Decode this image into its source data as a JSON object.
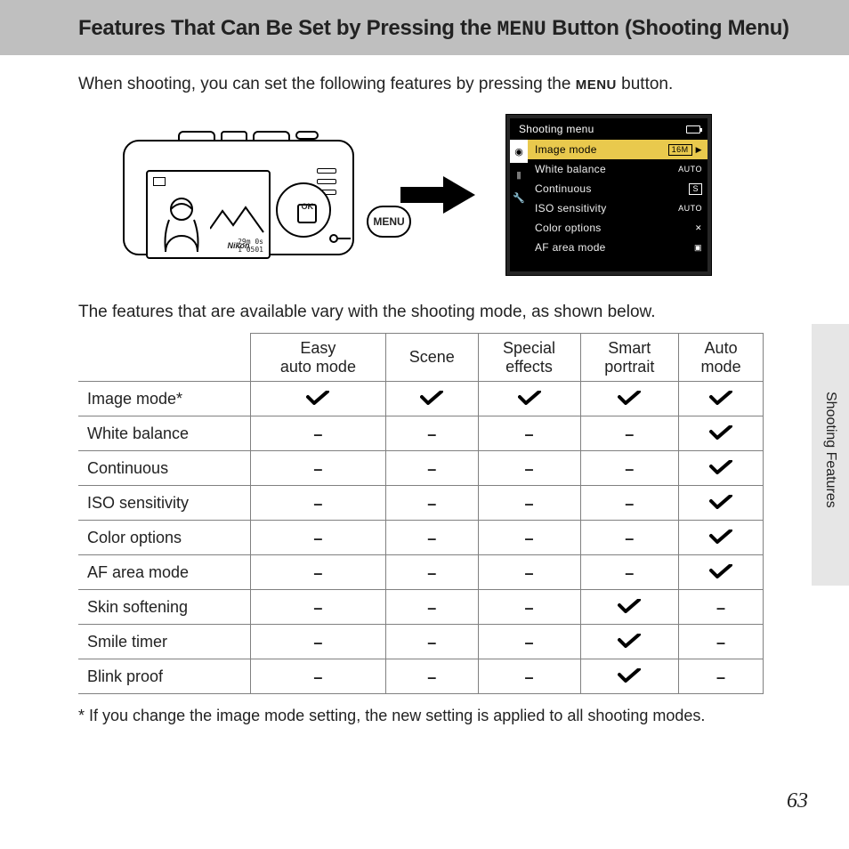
{
  "title": {
    "pre": "Features That Can Be Set by Pressing the ",
    "menu_word": "MENU",
    "post": " Button (Shooting Menu)"
  },
  "intro": {
    "pre": "When shooting, you can set the following features by pressing the ",
    "menu_word": "MENU",
    "post": " button."
  },
  "callout": {
    "menu_label": "MENU"
  },
  "camera": {
    "brand": "Nikon",
    "ok": "OK"
  },
  "shooting_menu": {
    "header": "Shooting menu",
    "rows": [
      {
        "label": "Image mode",
        "value": "16M",
        "style": "chip",
        "selected": true
      },
      {
        "label": "White balance",
        "value": "AUTO",
        "style": "text"
      },
      {
        "label": "Continuous",
        "value": "S",
        "style": "chip"
      },
      {
        "label": "ISO sensitivity",
        "value": "AUTO",
        "style": "text"
      },
      {
        "label": "Color options",
        "value": "✕",
        "style": "icon"
      },
      {
        "label": "AF area mode",
        "value": "▣",
        "style": "icon"
      }
    ]
  },
  "para2": "The features that are available vary with the shooting mode, as shown below.",
  "table": {
    "columns": [
      "Easy auto mode",
      "Scene",
      "Special effects",
      "Smart portrait",
      "Auto mode"
    ],
    "rows": [
      {
        "label": "Image mode*",
        "cells": [
          "check",
          "check",
          "check",
          "check",
          "check"
        ]
      },
      {
        "label": "White balance",
        "cells": [
          "dash",
          "dash",
          "dash",
          "dash",
          "check"
        ]
      },
      {
        "label": "Continuous",
        "cells": [
          "dash",
          "dash",
          "dash",
          "dash",
          "check"
        ]
      },
      {
        "label": "ISO sensitivity",
        "cells": [
          "dash",
          "dash",
          "dash",
          "dash",
          "check"
        ]
      },
      {
        "label": "Color options",
        "cells": [
          "dash",
          "dash",
          "dash",
          "dash",
          "check"
        ]
      },
      {
        "label": "AF area mode",
        "cells": [
          "dash",
          "dash",
          "dash",
          "dash",
          "check"
        ]
      },
      {
        "label": "Skin softening",
        "cells": [
          "dash",
          "dash",
          "dash",
          "check",
          "dash"
        ]
      },
      {
        "label": "Smile timer",
        "cells": [
          "dash",
          "dash",
          "dash",
          "check",
          "dash"
        ]
      },
      {
        "label": "Blink proof",
        "cells": [
          "dash",
          "dash",
          "dash",
          "check",
          "dash"
        ]
      }
    ]
  },
  "footnote": "*  If you change the image mode setting, the new setting is applied to all shooting modes.",
  "side_label": "Shooting Features",
  "page_number": "63"
}
